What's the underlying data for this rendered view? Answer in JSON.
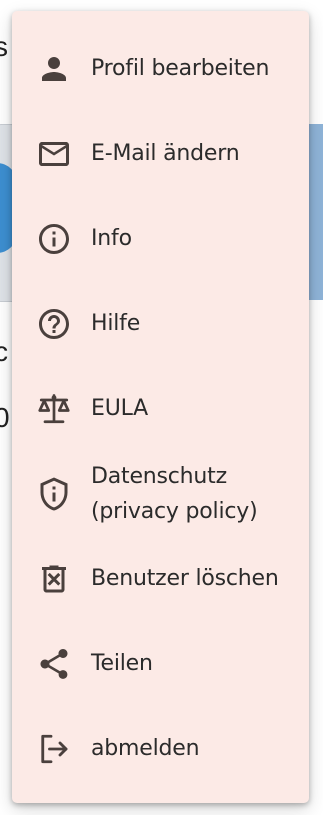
{
  "background": {
    "fragment_1": "s",
    "fragment_2": "c",
    "fragment_3": "0"
  },
  "menu": {
    "items": [
      {
        "label": "Profil bearbeiten",
        "icon": "person-icon"
      },
      {
        "label": "E-Mail ändern",
        "icon": "mail-icon"
      },
      {
        "label": "Info",
        "icon": "info-icon"
      },
      {
        "label": "Hilfe",
        "icon": "help-icon"
      },
      {
        "label": "EULA",
        "icon": "scale-icon"
      },
      {
        "label": "Datenschutz\n(privacy policy)",
        "icon": "shield-icon"
      },
      {
        "label": "Benutzer löschen",
        "icon": "delete-icon"
      },
      {
        "label": "Teilen",
        "icon": "share-icon"
      },
      {
        "label": "abmelden",
        "icon": "logout-icon"
      }
    ]
  },
  "colors": {
    "menu_background": "#fceae6",
    "icon": "#4a403d",
    "text": "#2b2b2b"
  }
}
